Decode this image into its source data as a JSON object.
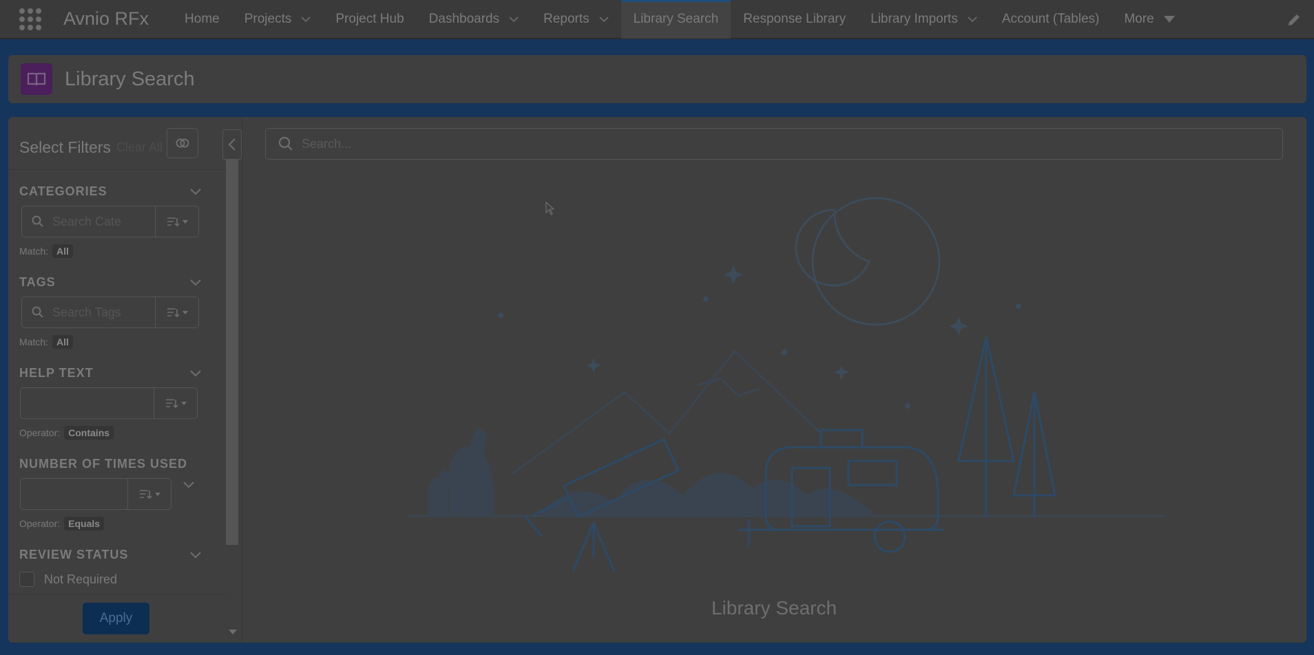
{
  "app": {
    "name": "Avnio RFx"
  },
  "nav": {
    "items": [
      {
        "label": "Home",
        "has_menu": false
      },
      {
        "label": "Projects",
        "has_menu": true
      },
      {
        "label": "Project Hub",
        "has_menu": false
      },
      {
        "label": "Dashboards",
        "has_menu": true
      },
      {
        "label": "Reports",
        "has_menu": true
      },
      {
        "label": "Library Search",
        "has_menu": false,
        "active": true
      },
      {
        "label": "Response Library",
        "has_menu": false
      },
      {
        "label": "Library Imports",
        "has_menu": true
      },
      {
        "label": "Account (Tables)",
        "has_menu": false
      },
      {
        "label": "More",
        "has_menu": true
      }
    ]
  },
  "header": {
    "title": "Library Search",
    "icon": "book-icon",
    "icon_color": "#7e2ea0"
  },
  "filters": {
    "title": "Select Filters",
    "clear_all": "Clear All",
    "sections": {
      "categories": {
        "title": "CATEGORIES",
        "placeholder": "Search Cate",
        "match_label": "Match:",
        "match_value": "All"
      },
      "tags": {
        "title": "TAGS",
        "placeholder": "Search Tags",
        "match_label": "Match:",
        "match_value": "All"
      },
      "help_text": {
        "title": "HELP TEXT",
        "value": "",
        "operator_label": "Operator:",
        "operator_value": "Contains"
      },
      "times_used": {
        "title": "NUMBER OF TIMES USED",
        "value": "",
        "operator_label": "Operator:",
        "operator_value": "Equals"
      },
      "review_status": {
        "title": "REVIEW STATUS",
        "options": [
          "Not Required"
        ]
      }
    },
    "apply_label": "Apply"
  },
  "search": {
    "placeholder": "Search..."
  },
  "empty_state": {
    "title": "Library Search"
  },
  "colors": {
    "accent": "#0176d3",
    "brand_dark": "#032d60"
  }
}
